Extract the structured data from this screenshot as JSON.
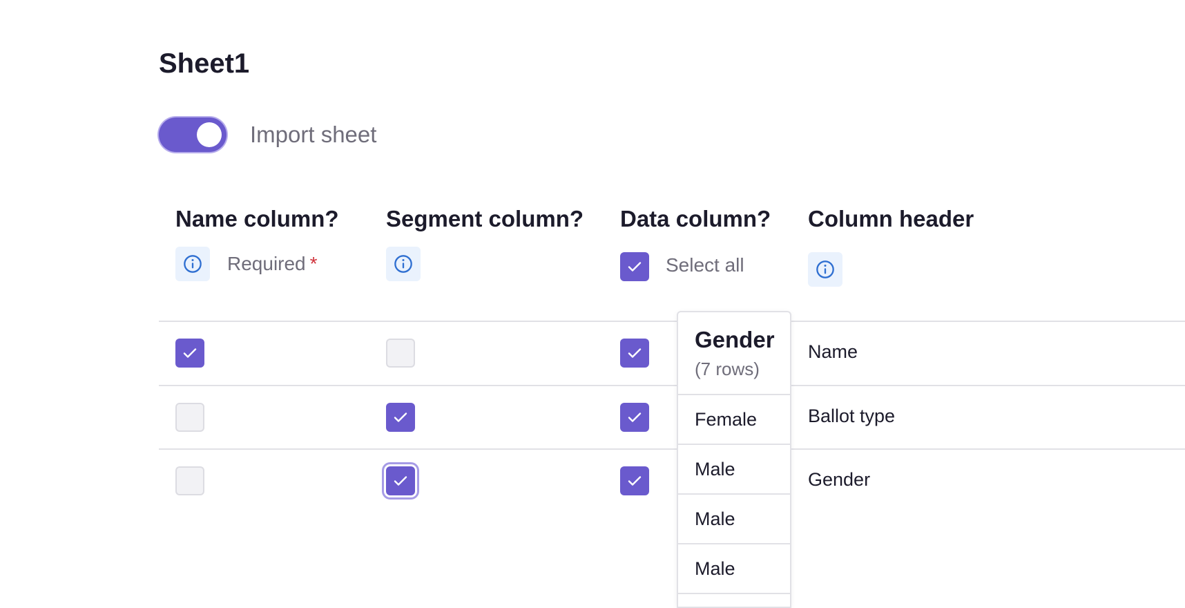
{
  "sheet": {
    "title": "Sheet1"
  },
  "import_toggle": {
    "label": "Import sheet",
    "enabled": true
  },
  "columns": {
    "name": {
      "header": "Name column?",
      "required_label": "Required",
      "required_marker": "*"
    },
    "segment": {
      "header": "Segment column?"
    },
    "data": {
      "header": "Data column?",
      "select_all_label": "Select all"
    },
    "column_header": {
      "header": "Column header"
    }
  },
  "rows": [
    {
      "name": true,
      "segment": false,
      "data": true,
      "header": "Name"
    },
    {
      "name": false,
      "segment": true,
      "data": true,
      "header": "Ballot type"
    },
    {
      "name": false,
      "segment": true,
      "data": true,
      "header": "Gender"
    }
  ],
  "preview": {
    "title": "Gender",
    "subtitle": "(7 rows)",
    "values": [
      "Female",
      "Male",
      "Male",
      "Male"
    ]
  },
  "colors": {
    "accent": "#6a5acd",
    "info_bg": "#eaf2fd",
    "info_icon": "#2f6fd1",
    "required": "#d0343d"
  },
  "icons": {
    "info": "info-icon",
    "check": "check-icon"
  }
}
